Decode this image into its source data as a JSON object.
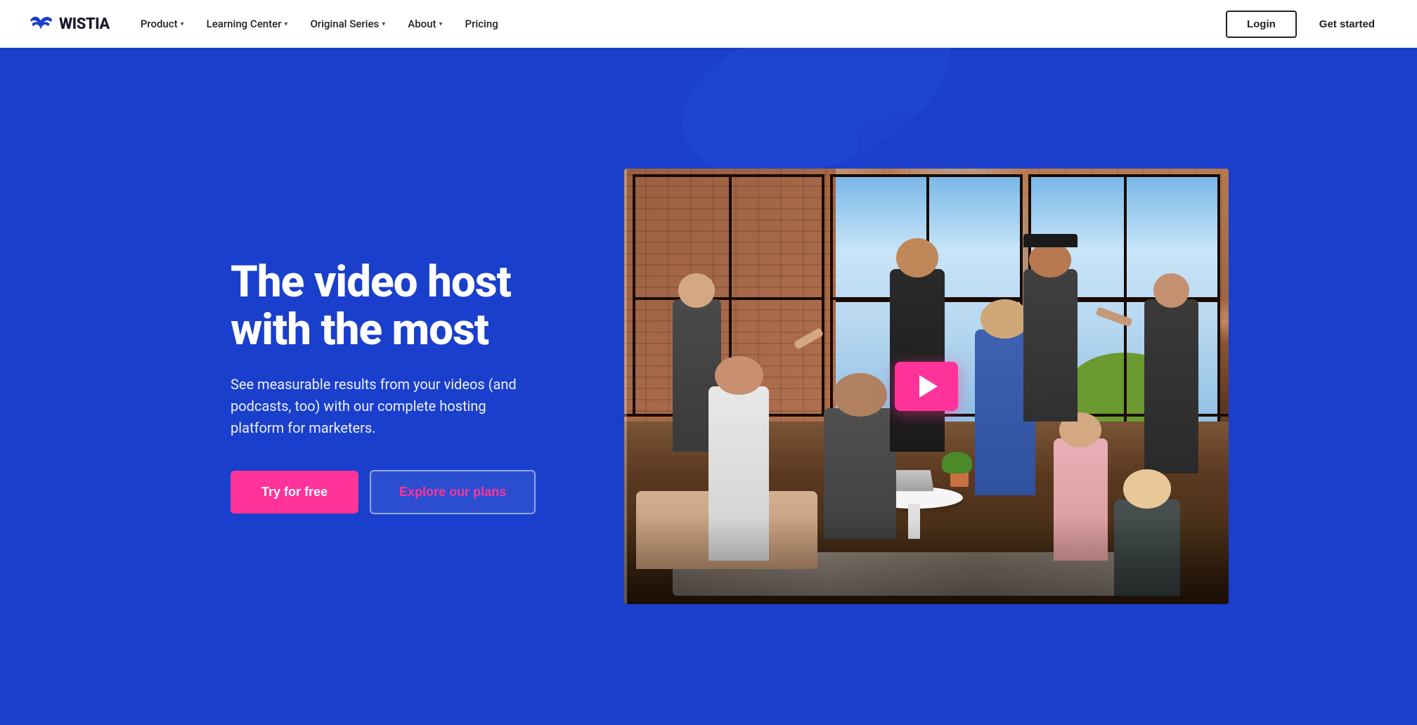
{
  "brand": {
    "logo_text": "WISTIA",
    "logo_icon_alt": "wistia-logo"
  },
  "nav": {
    "links": [
      {
        "id": "product",
        "label": "Product",
        "has_dropdown": true
      },
      {
        "id": "learning_center",
        "label": "Learning Center",
        "has_dropdown": true
      },
      {
        "id": "original_series",
        "label": "Original Series",
        "has_dropdown": true
      },
      {
        "id": "about",
        "label": "About",
        "has_dropdown": true
      },
      {
        "id": "pricing",
        "label": "Pricing",
        "has_dropdown": false
      }
    ],
    "login_label": "Login",
    "get_started_label": "Get started"
  },
  "hero": {
    "headline": "The video host with the most",
    "subtext": "See measurable results from your videos (and podcasts, too) with our complete hosting platform for marketers.",
    "cta_primary": "Try for free",
    "cta_secondary": "Explore our plans",
    "video_alt": "Wistia team photo"
  },
  "colors": {
    "hero_bg": "#1a3fcc",
    "cta_primary_bg": "#ff3399",
    "cta_secondary_border": "rgba(255,255,255,0.5)",
    "play_btn": "#ff3399",
    "nav_bg": "#ffffff",
    "headline": "#ffffff",
    "subtext": "rgba(255,255,255,0.92)"
  }
}
